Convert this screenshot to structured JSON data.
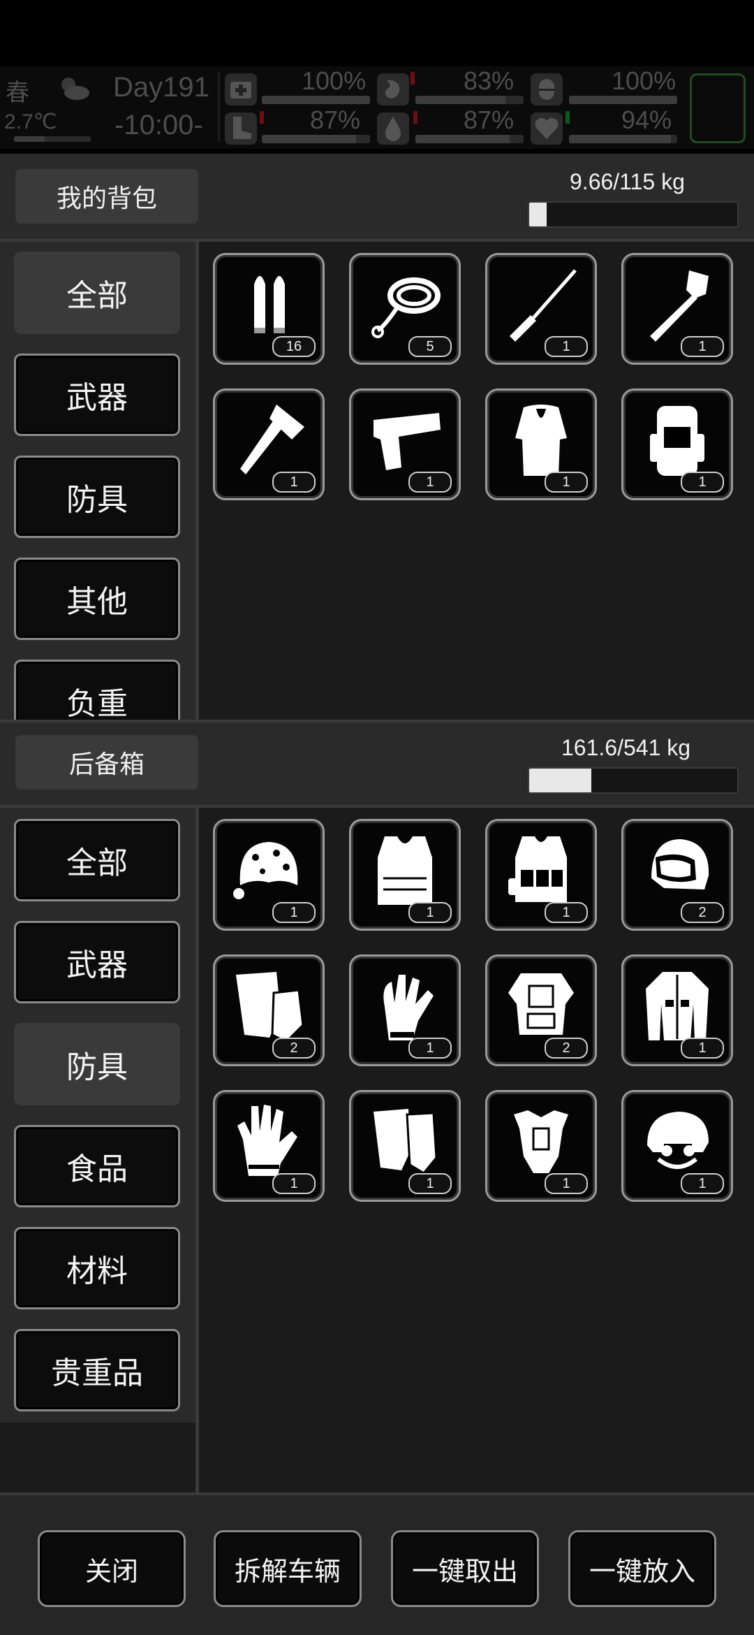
{
  "status": {
    "season": "春",
    "temperature": "2.7℃",
    "day": "Day191",
    "time": "-10:00-",
    "stats": [
      {
        "name": "health",
        "icon": "medkit-icon",
        "value": "100%",
        "level": 1.0
      },
      {
        "name": "hunger",
        "icon": "stomach-icon",
        "value": "83%",
        "level": 0.83
      },
      {
        "name": "stamina",
        "icon": "capsule-icon",
        "value": "100%",
        "level": 1.0
      },
      {
        "name": "speed",
        "icon": "boot-icon",
        "value": "87%",
        "level": 0.87
      },
      {
        "name": "thirst",
        "icon": "water-drop-icon",
        "value": "87%",
        "level": 0.87
      },
      {
        "name": "mood",
        "icon": "heart-icon",
        "value": "94%",
        "level": 0.94
      }
    ]
  },
  "backpack": {
    "title": "我的背包",
    "weight_text": "9.66/115  kg",
    "weight_level": 0.084,
    "tabs": [
      "全部",
      "武器",
      "防具",
      "其他",
      "负重"
    ],
    "active_tab": 0,
    "items": [
      {
        "icon": "bullets-icon",
        "count": "16"
      },
      {
        "icon": "rope-icon",
        "count": "5"
      },
      {
        "icon": "screwdriver-icon",
        "count": "1"
      },
      {
        "icon": "shovel-icon",
        "count": "1"
      },
      {
        "icon": "axe-icon",
        "count": "1"
      },
      {
        "icon": "pistol-icon",
        "count": "1"
      },
      {
        "icon": "fur-coat-icon",
        "count": "1"
      },
      {
        "icon": "hiking-backpack-icon",
        "count": "1"
      }
    ]
  },
  "trunk": {
    "title": "后备箱",
    "weight_text": "161.6/541  kg",
    "weight_level": 0.299,
    "tabs": [
      "全部",
      "武器",
      "防具",
      "食品",
      "材料",
      "贵重品"
    ],
    "active_tab": 2,
    "items": [
      {
        "icon": "leopard-hat-icon",
        "count": "1"
      },
      {
        "icon": "bulletproof-vest-icon",
        "count": "1"
      },
      {
        "icon": "tactical-vest-icon",
        "count": "1"
      },
      {
        "icon": "visor-helmet-icon",
        "count": "2"
      },
      {
        "icon": "fingerless-gloves-icon",
        "count": "2"
      },
      {
        "icon": "glove-icon",
        "count": "1"
      },
      {
        "icon": "body-armor-icon",
        "count": "2"
      },
      {
        "icon": "jacket-icon",
        "count": "1"
      },
      {
        "icon": "work-gloves-icon",
        "count": "1"
      },
      {
        "icon": "half-gloves-icon",
        "count": "1"
      },
      {
        "icon": "chest-armor-icon",
        "count": "1"
      },
      {
        "icon": "combat-helmet-icon",
        "count": "1"
      }
    ]
  },
  "footer": {
    "buttons": [
      "关闭",
      "拆解车辆",
      "一键取出",
      "一键放入"
    ]
  }
}
